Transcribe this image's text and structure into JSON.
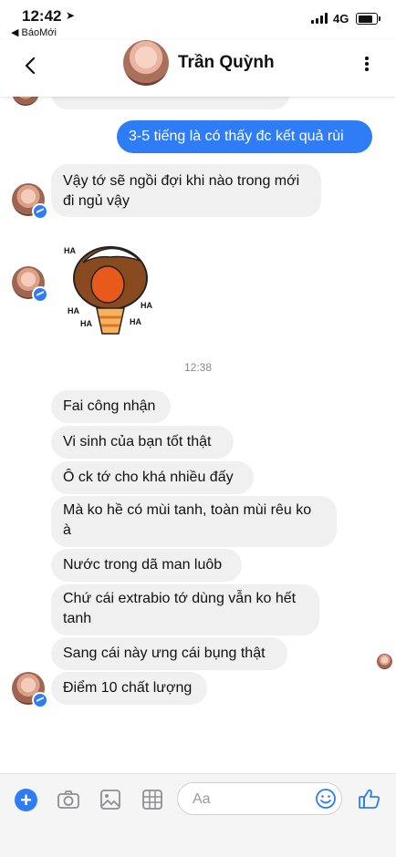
{
  "status_bar": {
    "time": "12:42",
    "back_app": "◀ BáoMới",
    "network": "4G"
  },
  "header": {
    "contact_name": "Trần Quỳnh"
  },
  "messages": [
    {
      "id": "out1",
      "text": "3-5 tiếng là có thấy đc kết quả rùi"
    },
    {
      "id": "in1a",
      "text": "Vậy tớ sẽ ngồi đợi khi nào trong mới"
    },
    {
      "id": "in1b",
      "text": "đi ngủ vậy"
    },
    {
      "id": "in2",
      "text": "Fai công nhận"
    },
    {
      "id": "in3",
      "text": "Vi sinh của bạn tốt thật"
    },
    {
      "id": "in4",
      "text": "Ô ck tớ cho khá nhiều đấy"
    },
    {
      "id": "in5a",
      "text": "Mà ko hề có mùi tanh, toàn mùi rêu ko"
    },
    {
      "id": "in5b",
      "text": "à"
    },
    {
      "id": "in6",
      "text": "Nước trong dã man luôb"
    },
    {
      "id": "in7a",
      "text": "Chứ cái extrabio tớ dùng vẫn ko hết"
    },
    {
      "id": "in7b",
      "text": "tanh"
    },
    {
      "id": "in8",
      "text": "Sang cái này ưng cái bụng thật"
    },
    {
      "id": "in9",
      "text": "Điểm 10 chất lượng"
    }
  ],
  "sticker": {
    "text": "HA"
  },
  "timestamp": "12:38",
  "composer": {
    "placeholder": "Aa"
  },
  "icons": [
    "back-chevron-icon",
    "more-vertical-icon",
    "plus-icon",
    "camera-icon",
    "photo-icon",
    "sticker-grid-icon",
    "emoji-icon",
    "thumbs-up-icon",
    "messenger-badge-icon",
    "location-arrow-icon"
  ],
  "colors": {
    "accent": "#2f7df6",
    "incoming_bubble": "#f0f0f0",
    "timestamp": "#8a8a8a"
  }
}
